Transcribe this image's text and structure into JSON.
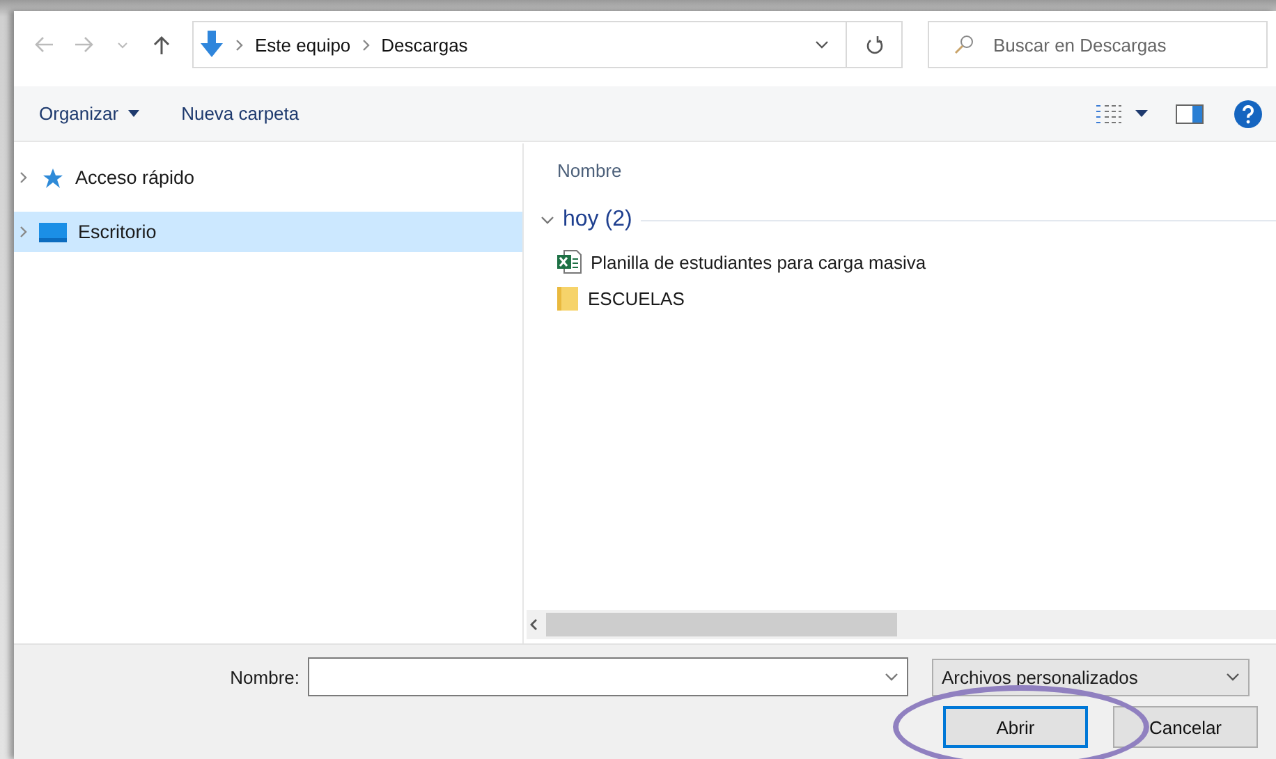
{
  "navigation": {
    "path": [
      {
        "label": "Este equipo"
      },
      {
        "label": "Descargas"
      }
    ]
  },
  "search": {
    "placeholder": "Buscar en Descargas"
  },
  "toolbar": {
    "buttons": [
      {
        "label": "Organizar",
        "dropdown": true
      },
      {
        "label": "Nueva carpeta",
        "dropdown": false
      }
    ]
  },
  "sidebar": {
    "items": [
      {
        "label": "Acceso rápido",
        "kind": "star",
        "selected": false
      },
      {
        "label": "Escritorio",
        "kind": "desktop",
        "selected": true
      }
    ]
  },
  "file_list": {
    "columns": [
      "Nombre"
    ],
    "groups": [
      {
        "label": "hoy (2)",
        "expanded": true,
        "items": [
          {
            "name": "Planilla de estudiantes para carga masiva",
            "kind": "spreadsheet"
          },
          {
            "name": "ESCUELAS",
            "kind": "folder"
          }
        ]
      }
    ]
  },
  "footer": {
    "name_label": "Nombre:",
    "file_type": "Archivos personalizados",
    "buttons": [
      {
        "label": "Abrir",
        "default": true
      },
      {
        "label": "Cancelar",
        "default": false
      }
    ]
  },
  "annotation": {
    "kind": "ellipse"
  }
}
